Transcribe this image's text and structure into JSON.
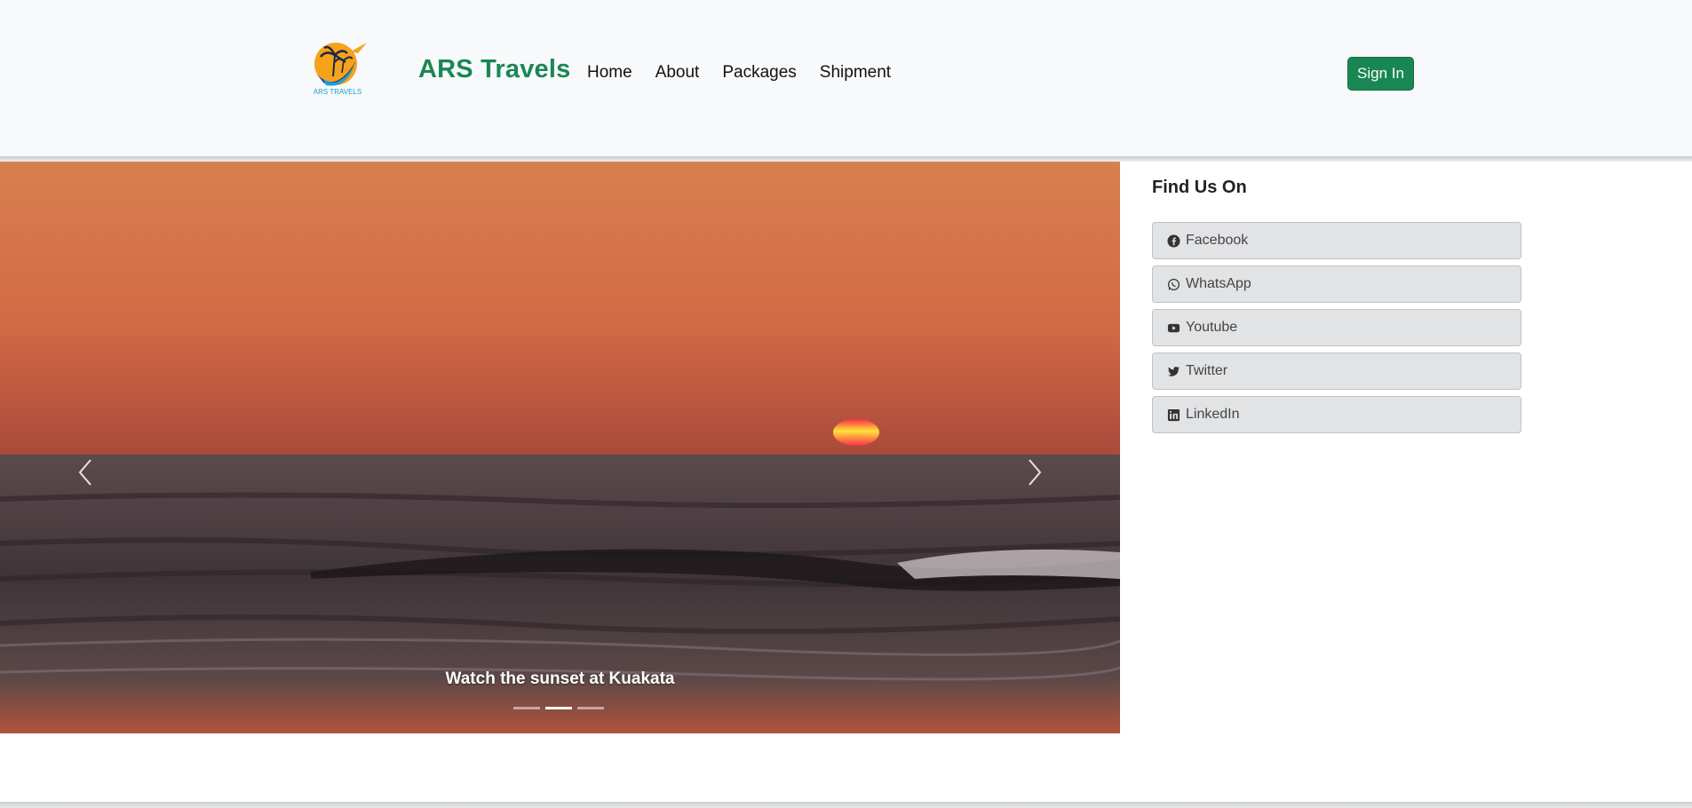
{
  "brand": {
    "logo_text": "ARS TRAVELS",
    "name": "ARS Travels"
  },
  "nav": {
    "items": [
      "Home",
      "About",
      "Packages",
      "Shipment"
    ],
    "signin_label": "Sign In"
  },
  "carousel": {
    "caption": "Watch the sunset at Kuakata",
    "slides_count": 3,
    "active_index": 1,
    "prev_icon": "chevron-left-icon",
    "next_icon": "chevron-right-icon"
  },
  "sidebar": {
    "title": "Find Us On",
    "links": [
      {
        "label": "Facebook",
        "icon": "facebook-icon"
      },
      {
        "label": "WhatsApp",
        "icon": "whatsapp-icon"
      },
      {
        "label": "Youtube",
        "icon": "youtube-icon"
      },
      {
        "label": "Twitter",
        "icon": "twitter-icon"
      },
      {
        "label": "LinkedIn",
        "icon": "linkedin-icon"
      }
    ]
  },
  "colors": {
    "brand_green": "#198754",
    "navbar_bg": "#f8f9fa",
    "social_bg": "#e2e3e5"
  }
}
